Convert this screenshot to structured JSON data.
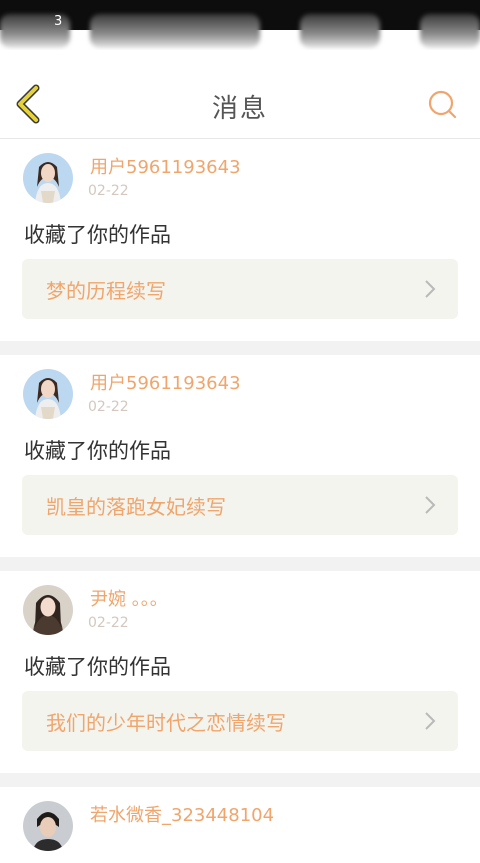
{
  "status_bar": {
    "time": "3"
  },
  "nav": {
    "title": "消息"
  },
  "colors": {
    "accent": "#f0a56c",
    "back_icon": "#e6d23a",
    "card_bg": "#f3f4ee",
    "separator": "#f2f2f2"
  },
  "notifications": [
    {
      "user": "用户5961193643",
      "date": "02-22",
      "action": "收藏了你的作品",
      "work_title": "梦的历程续写"
    },
    {
      "user": "用户5961193643",
      "date": "02-22",
      "action": "收藏了你的作品",
      "work_title": "凯皇的落跑女妃续写"
    },
    {
      "user": "尹婉 。。。",
      "date": "02-22",
      "action": "收藏了你的作品",
      "work_title": "我们的少年时代之恋情续写"
    },
    {
      "user": "若水微香_323448104"
    }
  ]
}
